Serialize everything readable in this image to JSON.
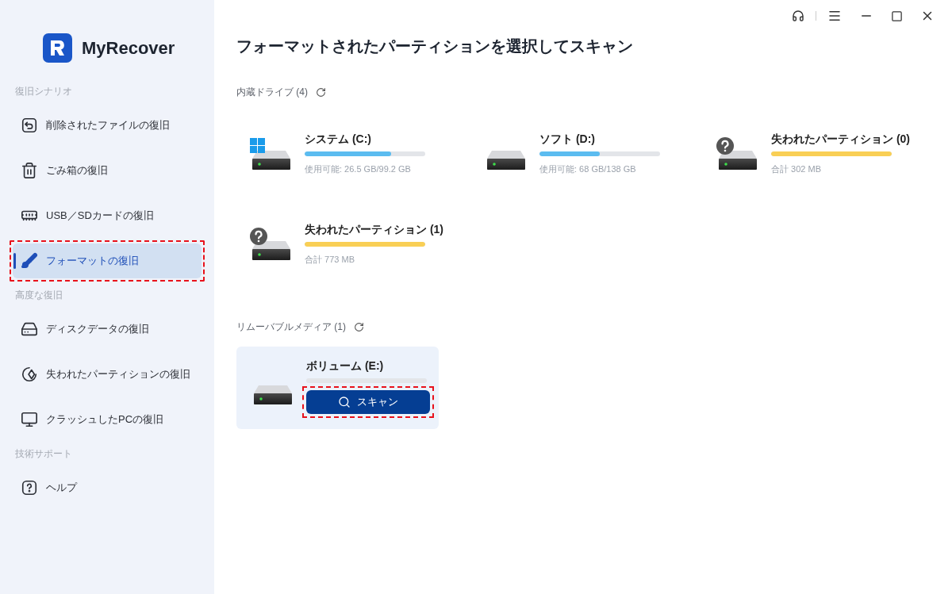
{
  "app": {
    "name": "MyRecover"
  },
  "sidebar": {
    "groups": [
      {
        "heading": "復旧シナリオ",
        "items": [
          {
            "label": "削除されたファイルの復旧",
            "selected": false,
            "annotated": false
          },
          {
            "label": "ごみ箱の復旧",
            "selected": false,
            "annotated": false
          },
          {
            "label": "USB／SDカードの復旧",
            "selected": false,
            "annotated": false
          },
          {
            "label": "フォーマットの復旧",
            "selected": true,
            "annotated": true
          }
        ]
      },
      {
        "heading": "高度な復旧",
        "items": [
          {
            "label": "ディスクデータの復旧",
            "selected": false,
            "annotated": false
          },
          {
            "label": "失われたパーティションの復旧",
            "selected": false,
            "annotated": false
          },
          {
            "label": "クラッシュしたPCの復旧",
            "selected": false,
            "annotated": false
          }
        ]
      },
      {
        "heading": "技術サポート",
        "items": [
          {
            "label": "ヘルプ",
            "selected": false,
            "annotated": false
          }
        ]
      }
    ]
  },
  "main": {
    "title": "フォーマットされたパーティションを選択してスキャン",
    "sections": [
      {
        "heading": "内蔵ドライブ (4)",
        "drives": [
          {
            "kind": "windows",
            "name": "システム (C:)",
            "level": 0.72,
            "color": "#5bbcf0",
            "info": "使用可能: 26.5 GB/99.2 GB"
          },
          {
            "kind": "plain",
            "name": "ソフト (D:)",
            "level": 0.5,
            "color": "#5bbcf0",
            "info": "使用可能: 68 GB/138 GB"
          },
          {
            "kind": "unknown",
            "name": "失われたパーティション (0)",
            "level": 1,
            "color": "#f9cf55",
            "info": "合計 302 MB"
          },
          {
            "kind": "unknown",
            "name": "失われたパーティション (1)",
            "level": 1,
            "color": "#f9cf55",
            "info": "合計 773 MB"
          }
        ]
      },
      {
        "heading": "リムーバブルメディア (1)",
        "drives": [
          {
            "kind": "plain",
            "name": "ボリューム (E:)",
            "hovered": true,
            "button": {
              "label": "スキャン",
              "annotated": true
            }
          }
        ]
      }
    ]
  }
}
